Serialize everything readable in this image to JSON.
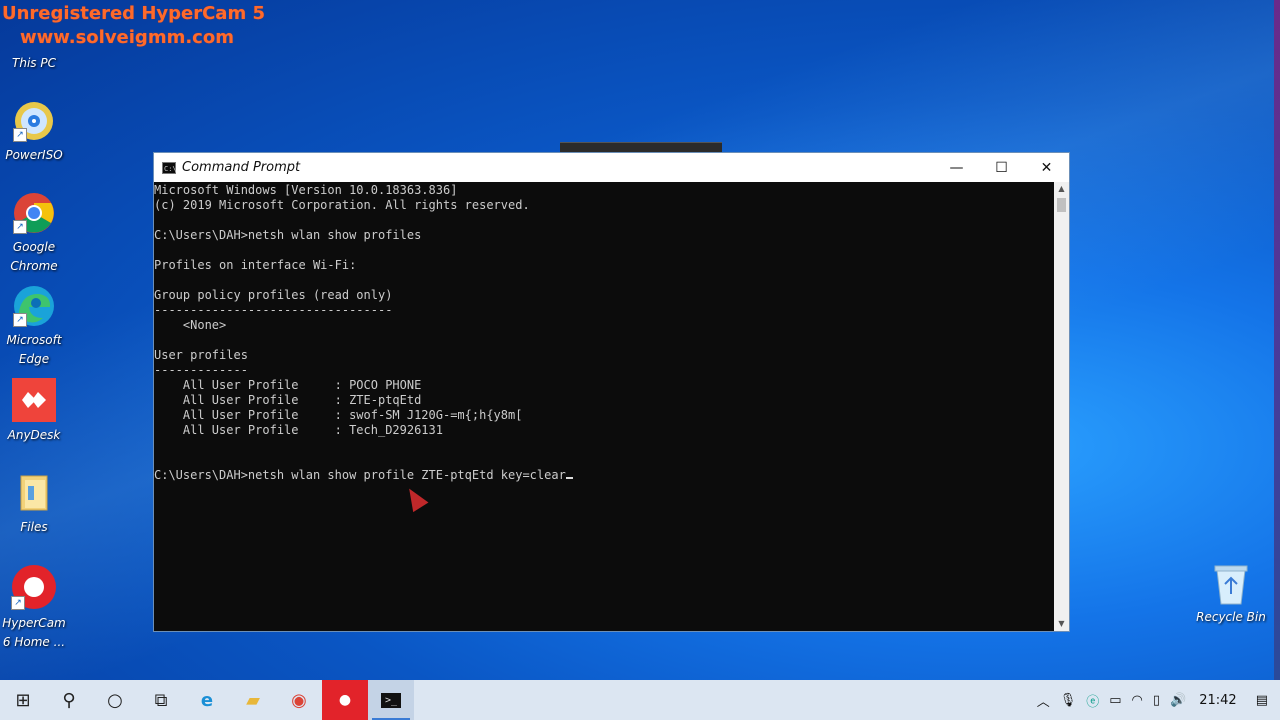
{
  "watermark": {
    "line1": "Unregistered HyperCam 5",
    "line2": "www.solveigmm.com"
  },
  "desktop_icons": [
    {
      "label": "This PC",
      "icon": "this-pc-icon"
    },
    {
      "label": "PowerISO",
      "icon": "poweriso-icon"
    },
    {
      "label": "Google Chrome",
      "icon": "chrome-icon"
    },
    {
      "label": "Microsoft Edge",
      "icon": "edge-icon"
    },
    {
      "label": "AnyDesk",
      "icon": "anydesk-icon"
    },
    {
      "label": "Files",
      "icon": "folder-icon"
    },
    {
      "label": "HyperCam 6 Home ...",
      "icon": "hypercam-icon"
    }
  ],
  "recycle_bin": {
    "label": "Recycle Bin"
  },
  "cmd": {
    "title": "Command Prompt",
    "lines": [
      "Microsoft Windows [Version 10.0.18363.836]",
      "(c) 2019 Microsoft Corporation. All rights reserved.",
      "",
      "C:\\Users\\DAH>netsh wlan show profiles",
      "",
      "Profiles on interface Wi-Fi:",
      "",
      "Group policy profiles (read only)",
      "---------------------------------",
      "    <None>",
      "",
      "User profiles",
      "-------------",
      "    All User Profile     : POCO PHONE",
      "    All User Profile     : ZTE-ptqEtd",
      "    All User Profile     : swof-SM J120G-=m{;h{y8m[",
      "    All User Profile     : Tech_D2926131",
      "",
      "",
      "C:\\Users\\DAH>netsh wlan show profile ZTE-ptqEtd key=clear"
    ],
    "buttons": {
      "minimize": "—",
      "maximize": "☐",
      "close": "✕"
    }
  },
  "taskbar": {
    "items": [
      {
        "icon": "windows-start-icon",
        "glyph": "⊞"
      },
      {
        "icon": "search-icon",
        "glyph": "⚲"
      },
      {
        "icon": "cortana-icon",
        "glyph": "○"
      },
      {
        "icon": "task-view-icon",
        "glyph": "⧉"
      },
      {
        "icon": "edge-icon",
        "glyph": "e"
      },
      {
        "icon": "file-explorer-icon",
        "glyph": "▰"
      },
      {
        "icon": "chrome-icon",
        "glyph": "◉"
      },
      {
        "icon": "hypercam-icon",
        "glyph": "●"
      },
      {
        "icon": "command-prompt-icon",
        "glyph": ">_"
      }
    ],
    "tray": {
      "chevron": "︿",
      "clock": "21:42"
    }
  },
  "colors": {
    "terminal_bg": "#0c0c0c",
    "terminal_fg": "#cccccc",
    "taskbar_bg": "#dce6f2",
    "watermark": "#ff6a2a"
  }
}
